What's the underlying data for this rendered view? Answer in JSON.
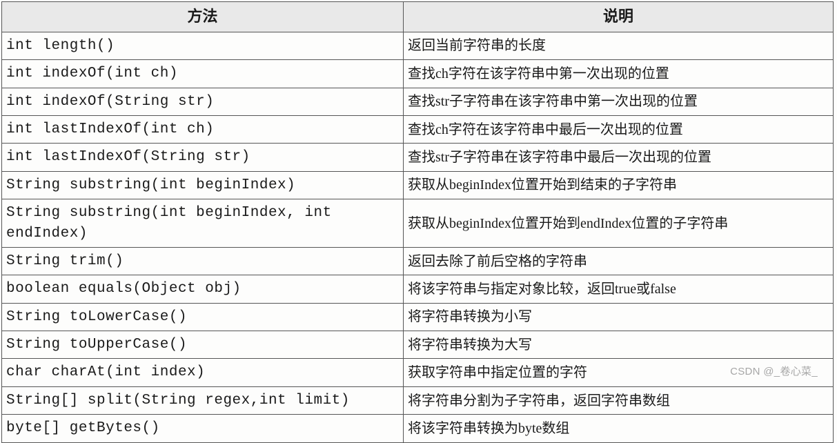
{
  "headers": {
    "method": "方法",
    "description": "说明"
  },
  "rows": [
    {
      "method": "int length()",
      "description": "返回当前字符串的长度"
    },
    {
      "method": "int indexOf(int ch)",
      "description": "查找ch字符在该字符串中第一次出现的位置"
    },
    {
      "method": "int indexOf(String str)",
      "description": "查找str子字符串在该字符串中第一次出现的位置"
    },
    {
      "method": "int lastIndexOf(int ch)",
      "description": "查找ch字符在该字符串中最后一次出现的位置"
    },
    {
      "method": "int lastIndexOf(String str)",
      "description": "查找str子字符串在该字符串中最后一次出现的位置"
    },
    {
      "method": "String substring(int beginIndex)",
      "description": "获取从beginIndex位置开始到结束的子字符串"
    },
    {
      "method": "String substring(int beginIndex, int endIndex)",
      "description": "获取从beginIndex位置开始到endIndex位置的子字符串"
    },
    {
      "method": "String trim()",
      "description": "返回去除了前后空格的字符串"
    },
    {
      "method": "boolean equals(Object obj)",
      "description": "将该字符串与指定对象比较，返回true或false"
    },
    {
      "method": "String toLowerCase()",
      "description": "将字符串转换为小写"
    },
    {
      "method": "String toUpperCase()",
      "description": "将字符串转换为大写"
    },
    {
      "method": "char charAt(int index)",
      "description": "获取字符串中指定位置的字符"
    },
    {
      "method": "String[] split(String regex,int limit)",
      "description": "将字符串分割为子字符串，返回字符串数组"
    },
    {
      "method": "byte[] getBytes()",
      "description": "将该字符串转换为byte数组"
    }
  ],
  "watermark": "CSDN @_卷心菜_"
}
